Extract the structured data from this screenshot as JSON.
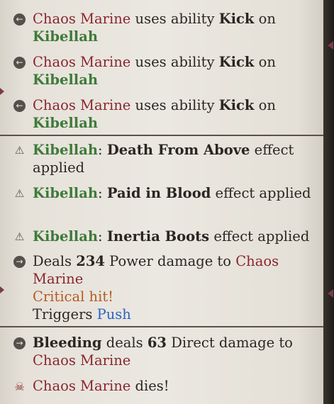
{
  "log": {
    "group1": [
      {
        "icon": "back-arrow-icon",
        "actor": "Chaos Marine",
        "verb": " uses ability ",
        "ability": "Kick",
        "prep": " on ",
        "target": "Kibellah"
      },
      {
        "icon": "back-arrow-icon",
        "actor": "Chaos Marine",
        "verb": " uses ability ",
        "ability": "Kick",
        "prep": " on ",
        "target": "Kibellah"
      },
      {
        "icon": "back-arrow-icon",
        "actor": "Chaos Marine",
        "verb": " uses ability ",
        "ability": "Kick",
        "prep": " on ",
        "target": "Kibellah"
      }
    ],
    "group2": [
      {
        "icon": "warning-icon",
        "actor": "Kibellah",
        "colon": ": ",
        "effect": "Death From Above",
        "tail": " effect applied"
      },
      {
        "icon": "warning-icon",
        "actor": "Kibellah",
        "colon": ": ",
        "effect": "Paid in Blood",
        "tail": " effect applied"
      },
      {
        "icon": "warning-icon",
        "actor": "Kibellah",
        "colon": ": ",
        "effect": "Inertia Boots",
        "tail": " effect applied"
      }
    ],
    "damage": {
      "icon": "forward-arrow-icon",
      "pre": "Deals ",
      "amount": "234",
      "mid": " Power damage to ",
      "target": "Chaos Marine",
      "crit": "Critical hit!",
      "triggers": "Triggers ",
      "triggered": "Push"
    },
    "bleed": {
      "icon": "forward-arrow-icon",
      "source": "Bleeding",
      "mid": " deals ",
      "amount": "63",
      "tail": " Direct damage to ",
      "target": "Chaos Marine"
    },
    "death": {
      "icon": "skull-icon",
      "actor": "Chaos Marine",
      "tail": " dies!"
    }
  },
  "colors": {
    "enemy": "#8a2530",
    "ally": "#3f7a3a",
    "crit": "#b65a24",
    "trigger": "#2c63c4"
  }
}
